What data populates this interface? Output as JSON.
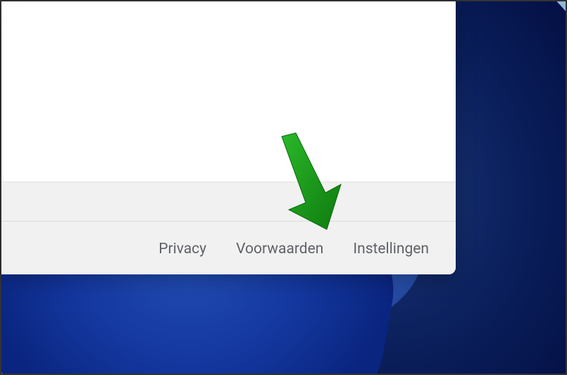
{
  "footer": {
    "links": [
      {
        "label": "Privacy"
      },
      {
        "label": "Voorwaarden"
      },
      {
        "label": "Instellingen"
      }
    ]
  },
  "annotation": {
    "arrow_color": "#1e9e1e"
  }
}
